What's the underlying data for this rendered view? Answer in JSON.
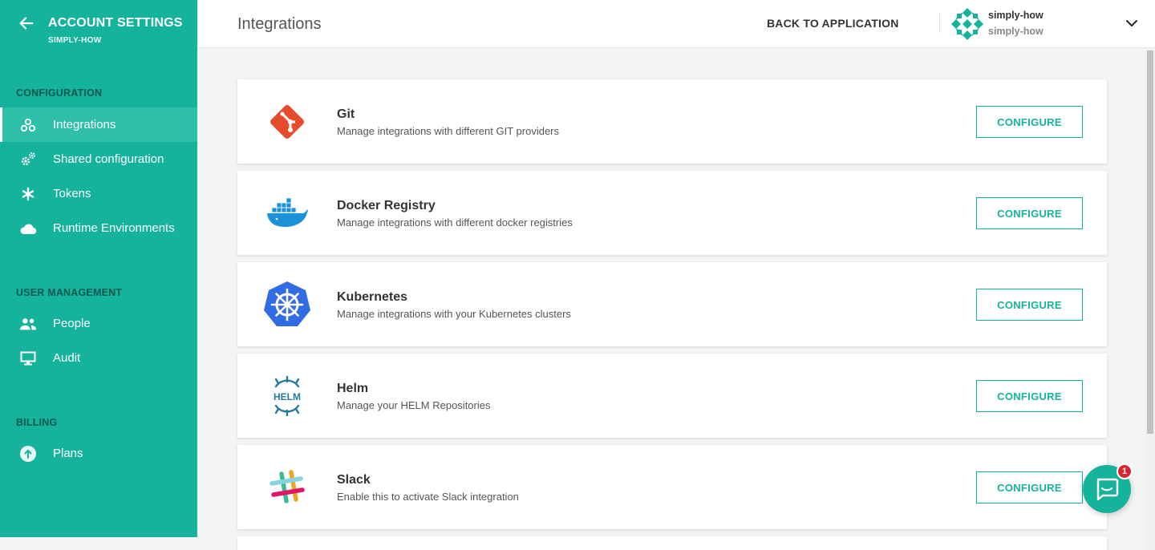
{
  "sidebar": {
    "title": "ACCOUNT SETTINGS",
    "subtitle": "SIMPLY-HOW",
    "sections": {
      "configuration": "CONFIGURATION",
      "user_management": "USER MANAGEMENT",
      "billing": "BILLING"
    },
    "items": [
      {
        "label": "Integrations",
        "icon": "integrations-icon",
        "active": true
      },
      {
        "label": "Shared configuration",
        "icon": "gears-icon"
      },
      {
        "label": "Tokens",
        "icon": "asterisk-icon"
      },
      {
        "label": "Runtime Environments",
        "icon": "cloud-icon"
      },
      {
        "label": "People",
        "icon": "people-icon"
      },
      {
        "label": "Audit",
        "icon": "monitor-icon"
      },
      {
        "label": "Plans",
        "icon": "upgrade-icon"
      }
    ]
  },
  "header": {
    "title": "Integrations",
    "back_label": "BACK TO APPLICATION",
    "account_name": "simply-how",
    "account_org": "simply-how"
  },
  "integrations": [
    {
      "title": "Git",
      "description": "Manage integrations with different GIT providers",
      "button": "CONFIGURE",
      "logo": "git-logo"
    },
    {
      "title": "Docker Registry",
      "description": "Manage integrations with different docker registries",
      "button": "CONFIGURE",
      "logo": "docker-logo"
    },
    {
      "title": "Kubernetes",
      "description": "Manage integrations with your Kubernetes clusters",
      "button": "CONFIGURE",
      "logo": "kubernetes-logo"
    },
    {
      "title": "Helm",
      "description": "Manage your HELM Repositories",
      "button": "CONFIGURE",
      "logo": "helm-logo"
    },
    {
      "title": "Slack",
      "description": "Enable this to activate Slack integration",
      "button": "CONFIGURE",
      "logo": "slack-logo"
    }
  ],
  "chat": {
    "badge": "1"
  },
  "colors": {
    "accent": "#15b39b",
    "active_item": "#2fbfa9"
  }
}
